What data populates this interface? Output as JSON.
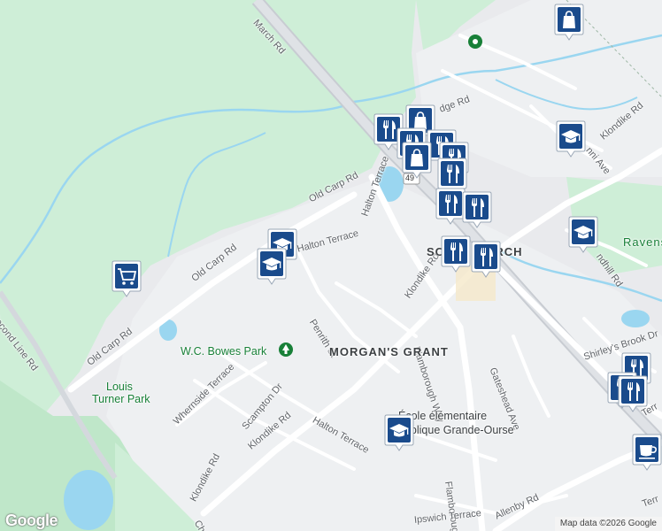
{
  "map": {
    "streets": {
      "march_rd": "March Rd",
      "second_line_rd": "Second Line Rd",
      "old_carp_rd_1": "Old Carp Rd",
      "old_carp_rd_2": "Old Carp Rd",
      "old_carp_rd_3": "Old Carp Rd",
      "halton_terrace_1": "Halton Terrace",
      "halton_terrace_2": "Halton Terrace",
      "halton_terrace_3": "Halton Terrace",
      "penrith_st": "Penrith St",
      "klondike_rd_1": "Klondike Rd",
      "klondike_rd_2": "Klondike Rd",
      "klondike_rd_3": "Klondike Rd",
      "klondike_rd_4": "Klondike Rd",
      "flamborough_way_1": "Flamborough Way",
      "flamborough_way_2": "Flamborough Wa",
      "whernside_terrace": "Whernside Terrace",
      "scampton_dr": "Scampton Dr",
      "gateshead_ave": "Gateshead Ave",
      "shirleys_brook_dr": "Shirley's Brook Dr",
      "ipswich_terrace": "Ipswich Terrace",
      "allenby_rd": "Allenby Rd",
      "penfield_partial": "dge Rd",
      "nni_ave": "nni Ave",
      "ndhill_rd": "ndhill Rd",
      "terr_partial_1": "Terr",
      "terr_partial_2": "Terr",
      "ch_partial": "Ch",
      "hwy_shield": "49"
    },
    "areas": {
      "morgans_grant": "MORGAN'S GRANT",
      "south_march": "SOUTH MARCH",
      "ravens": "Ravens"
    },
    "pois": {
      "wc_bowes_park": "W.C. Bowes Park",
      "louis_turner_park_1": "Louis",
      "louis_turner_park_2": "Turner Park",
      "ecole_1": "École élémentaire",
      "ecole_2": "publique Grande-Ourse"
    },
    "markers": [
      {
        "kind": "shopping-bag",
        "name": "shopping-marker-top"
      },
      {
        "kind": "restaurant",
        "name": "restaurant-marker"
      },
      {
        "kind": "school",
        "name": "school-marker"
      },
      {
        "kind": "grocery-cart",
        "name": "grocery-marker"
      },
      {
        "kind": "coffee",
        "name": "cafe-marker"
      }
    ],
    "footer": {
      "logo": "Google",
      "attribution": "Map data ©2026 Google"
    }
  },
  "colors": {
    "land": "#e9eaed",
    "green": "#ceeed7",
    "forest": "#bfe7c9",
    "water": "#9ad6f0",
    "road": "#ffffff",
    "highway": "#d4d8dd",
    "marker_blue": "#1a4b8c"
  }
}
